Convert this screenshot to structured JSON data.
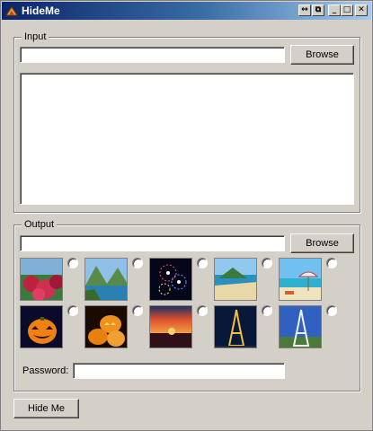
{
  "window": {
    "title": "HideMe",
    "icon": "app-icon",
    "title_buttons": [
      {
        "name": "restore-icon",
        "glyph": "↔"
      },
      {
        "name": "copy-icon",
        "glyph": "⧉"
      },
      {
        "name": "minimize-icon",
        "glyph": "_"
      },
      {
        "name": "maximize-icon",
        "glyph": "□"
      },
      {
        "name": "close-icon",
        "glyph": "✕"
      }
    ]
  },
  "input_group": {
    "legend": "Input",
    "path_value": "",
    "browse_label": "Browse",
    "text_value": ""
  },
  "output_group": {
    "legend": "Output",
    "path_value": "",
    "browse_label": "Browse",
    "images": [
      {
        "name": "flowers-image",
        "selected": false
      },
      {
        "name": "lake-mountains-image",
        "selected": false
      },
      {
        "name": "fireworks-image",
        "selected": false
      },
      {
        "name": "beach-island-image",
        "selected": false
      },
      {
        "name": "beach-umbrella-image",
        "selected": false
      },
      {
        "name": "pumpkin-image",
        "selected": false
      },
      {
        "name": "pumpkins-group-image",
        "selected": false
      },
      {
        "name": "sunset-image",
        "selected": false
      },
      {
        "name": "eiffel-tower-night-image",
        "selected": false
      },
      {
        "name": "eiffel-tower-day-image",
        "selected": false
      }
    ],
    "password_label": "Password:",
    "password_value": ""
  },
  "actions": {
    "hide_label": "Hide Me"
  }
}
